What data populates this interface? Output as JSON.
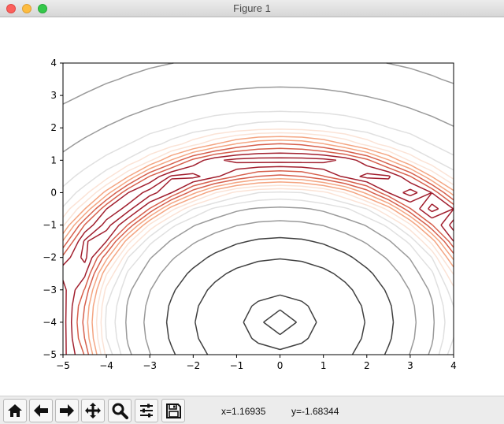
{
  "window": {
    "title": "Figure 1"
  },
  "toolbar": {
    "buttons": [
      {
        "name": "home-icon"
      },
      {
        "name": "back-arrow-icon"
      },
      {
        "name": "forward-arrow-icon"
      },
      {
        "name": "pan-move-icon"
      },
      {
        "name": "zoom-magnifier-icon"
      },
      {
        "name": "configure-subplots-icon"
      },
      {
        "name": "save-floppy-icon"
      }
    ],
    "x_readout": "x=1.16935",
    "y_readout": "y=-1.68344"
  },
  "chart_data": {
    "type": "contour",
    "title": "",
    "xlabel": "",
    "ylabel": "",
    "xlim": [
      -5,
      4
    ],
    "ylim": [
      -5,
      4
    ],
    "xticks": [
      "−5",
      "−4",
      "−3",
      "−2",
      "−1",
      "0",
      "1",
      "2",
      "3",
      "4"
    ],
    "yticks": [
      "−5",
      "−4",
      "−3",
      "−2",
      "−1",
      "0",
      "1",
      "2",
      "3",
      "4"
    ],
    "grid": false,
    "colormap": "RdGy",
    "colors": {
      "dark_red": "#a11f2e",
      "mid_red": "#d6604d",
      "light_orange": "#f4a582",
      "pale": "#fbe3d6",
      "pale_gray": "#e0e0e0",
      "mid_gray": "#9a9a9a",
      "dark_gray": "#404040"
    }
  }
}
